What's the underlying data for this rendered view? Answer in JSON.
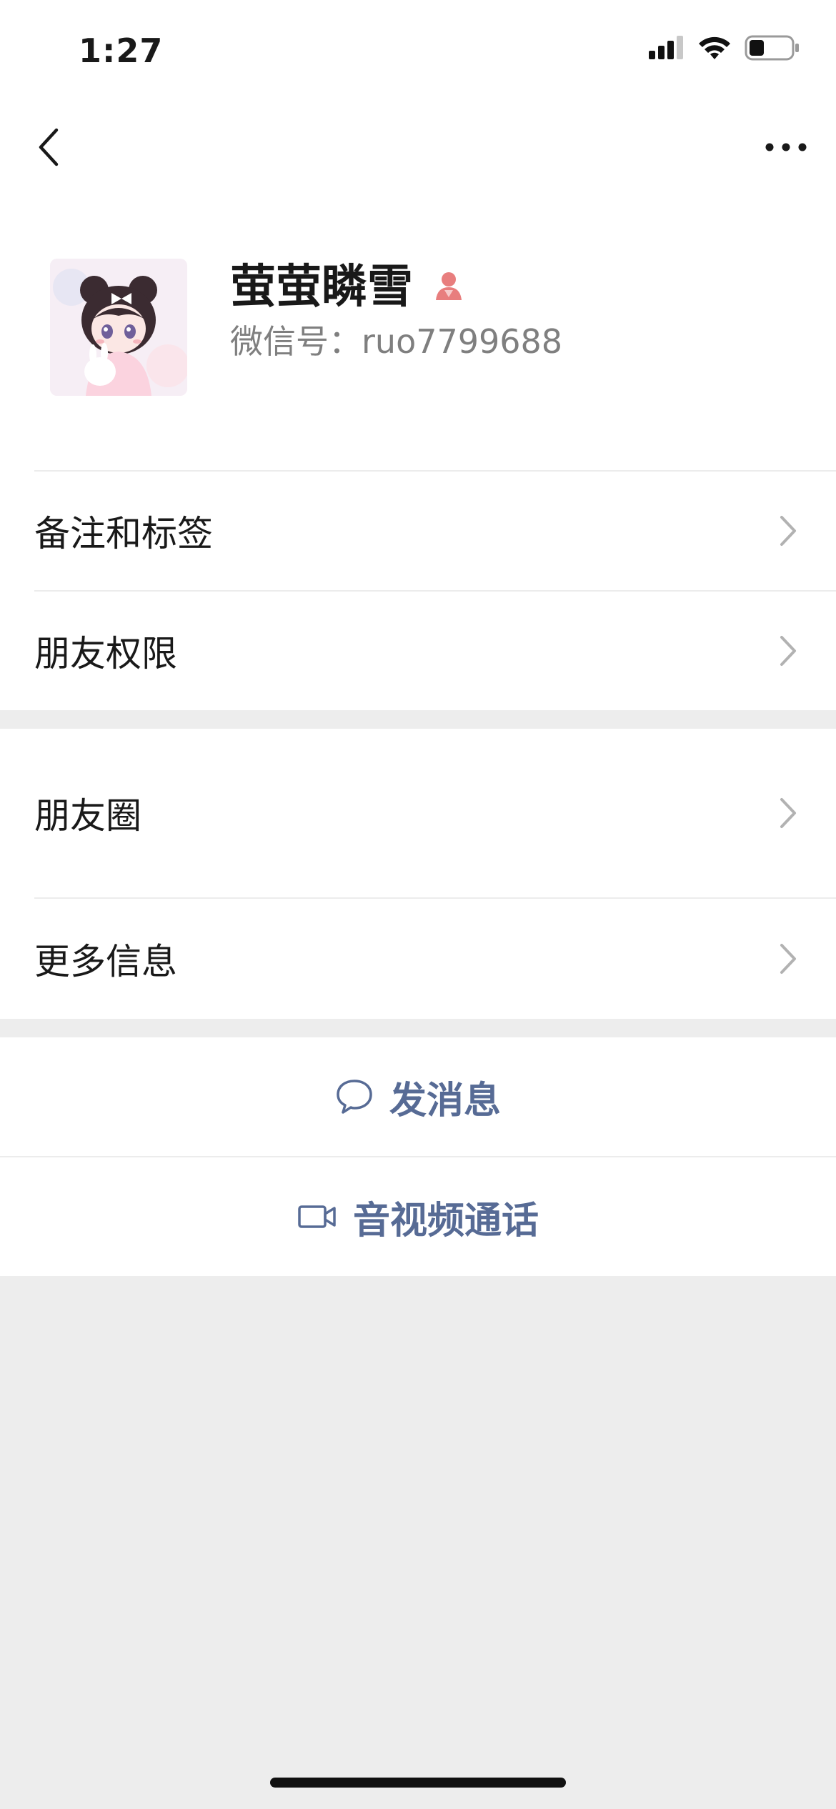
{
  "status_bar": {
    "time": "1:27",
    "icons": [
      "signal-icon",
      "wifi-icon",
      "battery-icon"
    ],
    "battery_level": 0.35
  },
  "topbar": {
    "back_icon": "chevron-left-icon",
    "more_icon": "more-dots-icon"
  },
  "profile": {
    "name": "萤萤瞵雪",
    "wechat_id": "微信号：ruo7799688",
    "gender_icon": "female-icon",
    "gender_color": "#e87e7e"
  },
  "menu": {
    "section1": [
      {
        "label": "备注和标签"
      },
      {
        "label": "朋友权限"
      }
    ],
    "section2": [
      {
        "label": "朋友圈"
      },
      {
        "label": "更多信息"
      }
    ]
  },
  "actions": {
    "message_label": "发消息",
    "message_icon": "chat-bubble-icon",
    "call_label": "音视频通话",
    "call_icon": "video-camera-icon",
    "accent": "#576b95"
  },
  "colors": {
    "background": "#ededed",
    "surface": "#ffffff",
    "text": "#191919",
    "secondary_text": "#7f7f7f"
  }
}
